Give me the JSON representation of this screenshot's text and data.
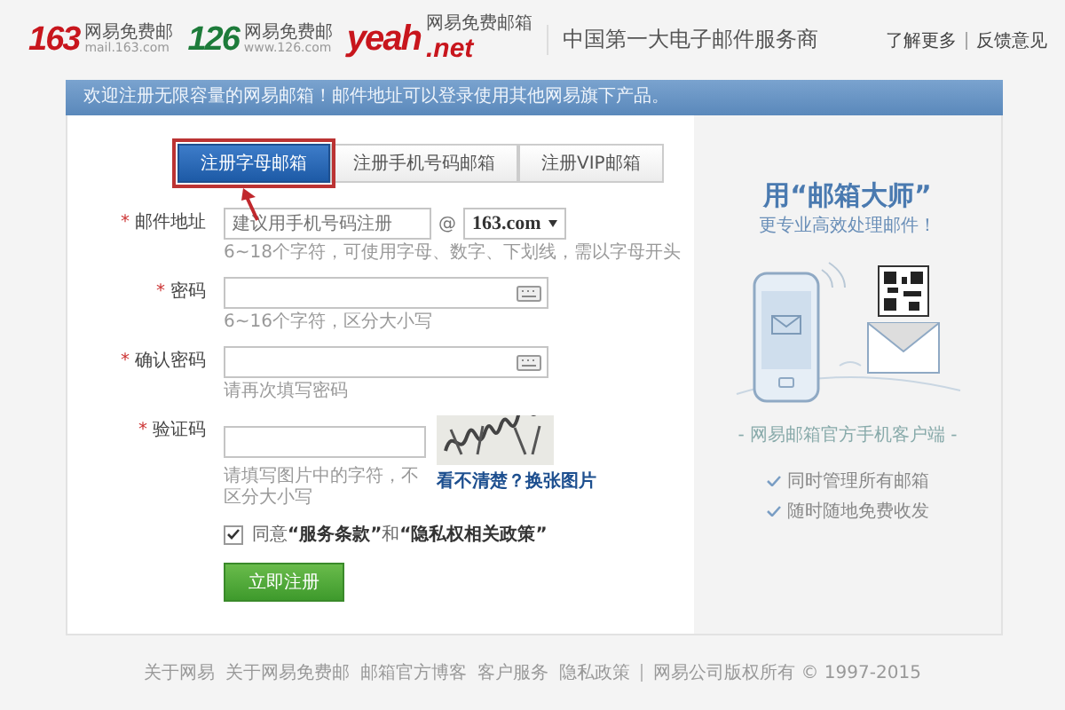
{
  "header": {
    "logos": [
      {
        "kind": "red",
        "mark": "163",
        "name": "网易免费邮",
        "url": "mail.163.com"
      },
      {
        "kind": "green",
        "mark": "126",
        "name": "网易免费邮",
        "url": "www.126.com"
      },
      {
        "kind": "yeah",
        "mark": "yeah",
        "suffix": ".net",
        "name": "网易免费邮箱"
      }
    ],
    "slogan": "中国第一大电子邮件服务商",
    "links": [
      "了解更多",
      "反馈意见"
    ]
  },
  "banner": "欢迎注册无限容量的网易邮箱！邮件地址可以登录使用其他网易旗下产品。",
  "tabs": [
    {
      "label": "注册字母邮箱",
      "selected": true
    },
    {
      "label": "注册手机号码邮箱",
      "selected": false
    },
    {
      "label": "注册VIP邮箱",
      "selected": false
    }
  ],
  "fields": [
    {
      "kind": "email",
      "required_mark": "*",
      "label": "邮件地址",
      "placeholder": "建议用手机号码注册",
      "at": "@",
      "domain": "163.com",
      "hint": "6~18个字符，可使用字母、数字、下划线，需以字母开头"
    },
    {
      "kind": "password",
      "required_mark": "*",
      "label": "密码",
      "hint": "6~16个字符，区分大小写"
    },
    {
      "kind": "password",
      "required_mark": "*",
      "label": "确认密码",
      "hint": "请再次填写密码"
    },
    {
      "kind": "captcha",
      "required_mark": "*",
      "label": "验证码",
      "hint": "请填写图片中的字符，不区分大小写",
      "refresh_link": "看不清楚？换张图片"
    }
  ],
  "agreement": {
    "checked": true,
    "text": "同意**“服务条款”**和**“隐私权相关政策”**"
  },
  "submit": "立即注册",
  "promo": {
    "title": "用“邮箱大师”",
    "subtitle": "更专业高效处理邮件！",
    "caption": "- 网易邮箱官方手机客户端 -",
    "features": [
      "同时管理所有邮箱",
      "随时随地免费收发"
    ]
  },
  "footer": {
    "links": [
      "关于网易",
      "关于网易免费邮",
      "邮箱官方博客",
      "客户服务",
      "隐私政策"
    ],
    "copyright": "网易公司版权所有 © 1997-2015"
  }
}
